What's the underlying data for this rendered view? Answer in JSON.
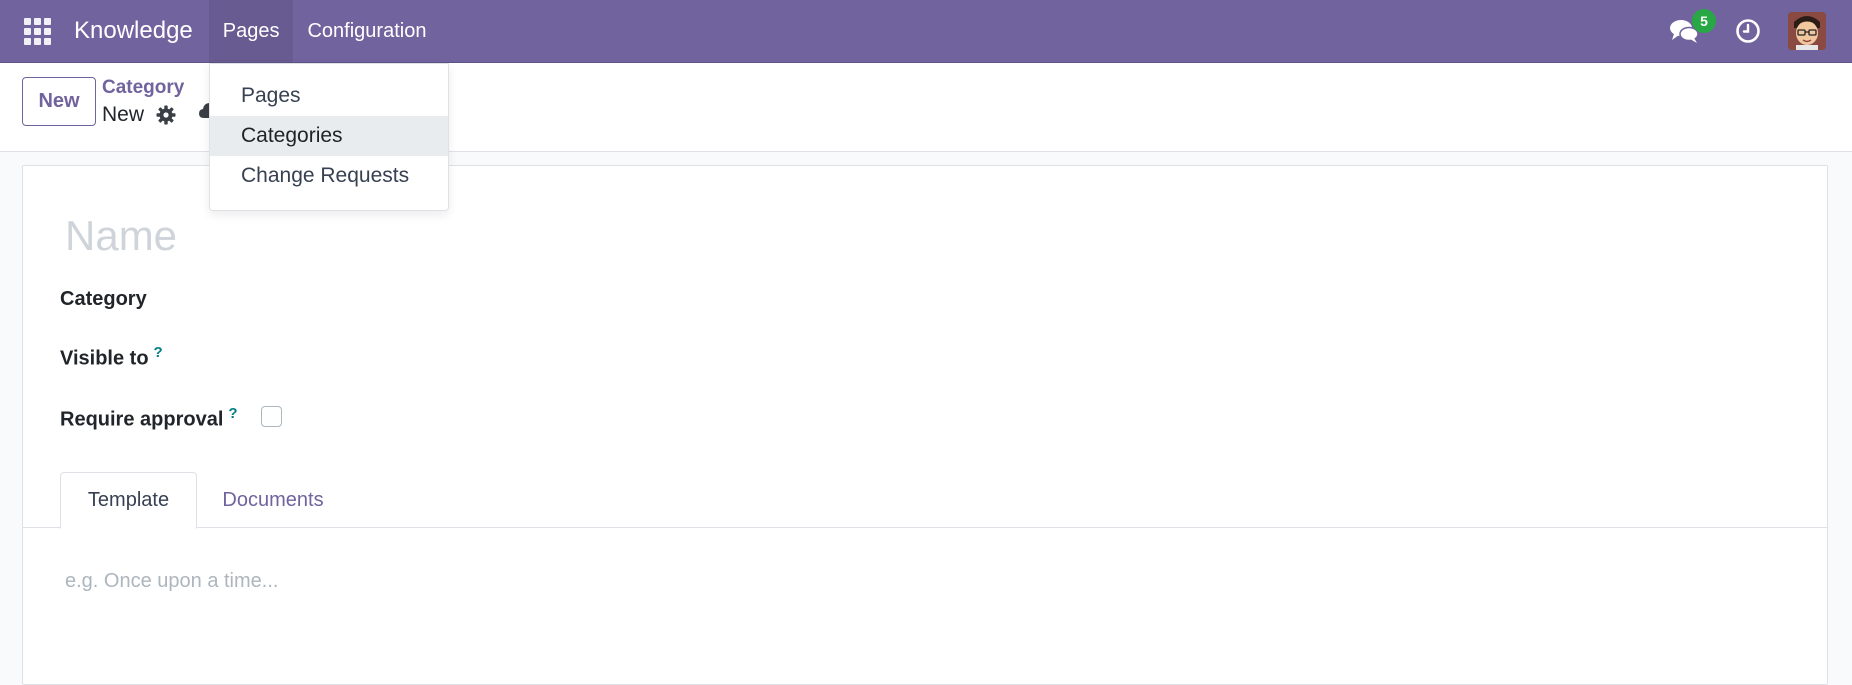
{
  "navbar": {
    "brand": "Knowledge",
    "menu": [
      {
        "label": "Pages",
        "active": true
      },
      {
        "label": "Configuration",
        "active": false
      }
    ],
    "chat_badge": "5",
    "accent_color": "#71639e"
  },
  "control_panel": {
    "new_label": "New",
    "breadcrumb": "Category",
    "record_title": "New"
  },
  "dropdown": {
    "items": [
      {
        "label": "Pages"
      },
      {
        "label": "Categories",
        "highlighted": true
      },
      {
        "label": "Change Requests"
      }
    ]
  },
  "form": {
    "name_placeholder": "Name",
    "fields": {
      "category_label": "Category",
      "visible_to_label": "Visible to",
      "require_approval_label": "Require approval",
      "help_mark": "?"
    },
    "require_approval_checked": false,
    "tabs": [
      {
        "label": "Template",
        "active": true
      },
      {
        "label": "Documents",
        "active": false
      }
    ],
    "template_placeholder": "e.g. Once upon a time..."
  }
}
